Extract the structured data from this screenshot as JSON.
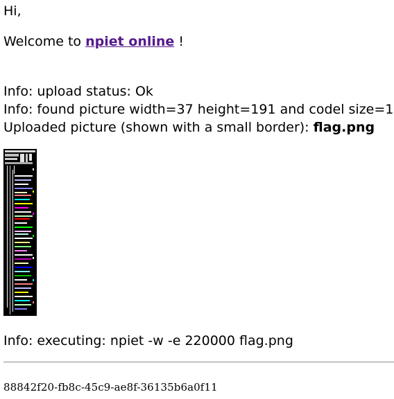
{
  "greeting": "Hi,",
  "welcome": {
    "prefix": "Welcome to",
    "link_text": "npiet online",
    "suffix": "!"
  },
  "info": {
    "upload_status": "Info: upload status: Ok",
    "found_picture": "Info: found picture width=37 height=191 and codel size=1",
    "uploaded_prefix": "Uploaded picture (shown with a small border):",
    "uploaded_filename": "flag.png",
    "executing": "Info: executing: npiet -w -e 220000 flag.png"
  },
  "output": {
    "id": "88842f20-fb8c-45c9-ae8f-36135b6a0f11"
  },
  "colors": {
    "link": "#551a8b",
    "picture_background": "#000000",
    "rule": "#9a9a9a"
  }
}
